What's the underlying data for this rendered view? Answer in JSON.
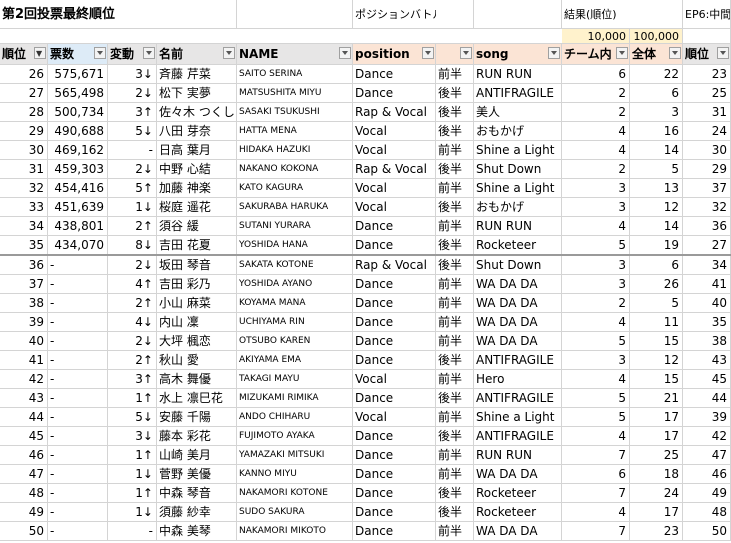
{
  "title": "第2回投票最終順位",
  "section_label": "ポジションバトル",
  "result_label": "結果(順位)",
  "ep_label": "EP6:中間",
  "value_a": "10,000",
  "value_b": "100,000",
  "headers": {
    "rank": "順位",
    "votes": "票数",
    "change": "変動",
    "name": "名前",
    "name_en": "NAME",
    "position": "position",
    "half": "",
    "song": "song",
    "team": "チーム内",
    "overall": "全体",
    "ep_rank": "順位"
  },
  "colors": {
    "header_peach": "#fbe4d5",
    "header_gray": "#e7e6e6",
    "header_teal": "#ddebf7",
    "value_yellow": "#fff2cc"
  },
  "rows": [
    {
      "rank": "26",
      "votes": "575,671",
      "change": "3↓",
      "name": "斉藤 芹菜",
      "name_en": "SAITO SERINA",
      "position": "Dance",
      "half": "前半",
      "song": "RUN RUN",
      "team": "6",
      "overall": "22",
      "ep": "23"
    },
    {
      "rank": "27",
      "votes": "565,498",
      "change": "2↓",
      "name": "松下 実夢",
      "name_en": "MATSUSHITA MIYU",
      "position": "Dance",
      "half": "後半",
      "song": "ANTIFRAGILE",
      "team": "2",
      "overall": "6",
      "ep": "25"
    },
    {
      "rank": "28",
      "votes": "500,734",
      "change": "3↑",
      "name": "佐々木 つくし",
      "name_en": "SASAKI TSUKUSHI",
      "position": "Rap & Vocal",
      "half": "後半",
      "song": "美人",
      "team": "2",
      "overall": "3",
      "ep": "31"
    },
    {
      "rank": "29",
      "votes": "490,688",
      "change": "5↓",
      "name": "八田 芽奈",
      "name_en": "HATTA MENA",
      "position": "Vocal",
      "half": "後半",
      "song": "おもかげ",
      "team": "4",
      "overall": "16",
      "ep": "24"
    },
    {
      "rank": "30",
      "votes": "469,162",
      "change": "-",
      "name": "日高 葉月",
      "name_en": "HIDAKA HAZUKI",
      "position": "Vocal",
      "half": "前半",
      "song": "Shine a Light",
      "team": "4",
      "overall": "14",
      "ep": "30"
    },
    {
      "rank": "31",
      "votes": "459,303",
      "change": "2↓",
      "name": "中野 心結",
      "name_en": "NAKANO KOKONA",
      "position": "Rap & Vocal",
      "half": "後半",
      "song": "Shut Down",
      "team": "2",
      "overall": "5",
      "ep": "29"
    },
    {
      "rank": "32",
      "votes": "454,416",
      "change": "5↑",
      "name": "加藤 神楽",
      "name_en": "KATO KAGURA",
      "position": "Vocal",
      "half": "前半",
      "song": "Shine a Light",
      "team": "3",
      "overall": "13",
      "ep": "37"
    },
    {
      "rank": "33",
      "votes": "451,639",
      "change": "1↓",
      "name": "桜庭 遥花",
      "name_en": "SAKURABA HARUKA",
      "position": "Vocal",
      "half": "後半",
      "song": "おもかげ",
      "team": "3",
      "overall": "12",
      "ep": "32"
    },
    {
      "rank": "34",
      "votes": "438,801",
      "change": "2↑",
      "name": "須谷 緩",
      "name_en": "SUTANI YURARA",
      "position": "Dance",
      "half": "前半",
      "song": "RUN RUN",
      "team": "4",
      "overall": "14",
      "ep": "36"
    },
    {
      "rank": "35",
      "votes": "434,070",
      "change": "8↓",
      "name": "吉田 花夏",
      "name_en": "YOSHIDA HANA",
      "position": "Dance",
      "half": "後半",
      "song": "Rocketeer",
      "team": "5",
      "overall": "19",
      "ep": "27"
    },
    {
      "rank": "36",
      "votes": "-",
      "change": "2↓",
      "name": "坂田 琴音",
      "name_en": "SAKATA KOTONE",
      "position": "Rap & Vocal",
      "half": "後半",
      "song": "Shut Down",
      "team": "3",
      "overall": "6",
      "ep": "34"
    },
    {
      "rank": "37",
      "votes": "-",
      "change": "4↑",
      "name": "吉田 彩乃",
      "name_en": "YOSHIDA AYANO",
      "position": "Dance",
      "half": "前半",
      "song": "WA DA DA",
      "team": "3",
      "overall": "26",
      "ep": "41"
    },
    {
      "rank": "38",
      "votes": "-",
      "change": "2↑",
      "name": "小山 麻菜",
      "name_en": "KOYAMA MANA",
      "position": "Dance",
      "half": "前半",
      "song": "WA DA DA",
      "team": "2",
      "overall": "5",
      "ep": "40"
    },
    {
      "rank": "39",
      "votes": "-",
      "change": "4↓",
      "name": "内山 凜",
      "name_en": "UCHIYAMA RIN",
      "position": "Dance",
      "half": "前半",
      "song": "WA DA DA",
      "team": "4",
      "overall": "11",
      "ep": "35"
    },
    {
      "rank": "40",
      "votes": "-",
      "change": "2↓",
      "name": "大坪 楓恋",
      "name_en": "OTSUBO KAREN",
      "position": "Dance",
      "half": "前半",
      "song": "WA DA DA",
      "team": "5",
      "overall": "15",
      "ep": "38"
    },
    {
      "rank": "41",
      "votes": "-",
      "change": "2↑",
      "name": "秋山 愛",
      "name_en": "AKIYAMA EMA",
      "position": "Dance",
      "half": "後半",
      "song": "ANTIFRAGILE",
      "team": "3",
      "overall": "12",
      "ep": "43"
    },
    {
      "rank": "42",
      "votes": "-",
      "change": "3↑",
      "name": "高木 舞優",
      "name_en": "TAKAGI MAYU",
      "position": "Vocal",
      "half": "前半",
      "song": "Hero",
      "team": "4",
      "overall": "15",
      "ep": "45"
    },
    {
      "rank": "43",
      "votes": "-",
      "change": "1↑",
      "name": "水上 凛巳花",
      "name_en": "MIZUKAMI RIMIKA",
      "position": "Dance",
      "half": "後半",
      "song": "ANTIFRAGILE",
      "team": "5",
      "overall": "21",
      "ep": "44"
    },
    {
      "rank": "44",
      "votes": "-",
      "change": "5↓",
      "name": "安藤 千陽",
      "name_en": "ANDO CHIHARU",
      "position": "Vocal",
      "half": "前半",
      "song": "Shine a Light",
      "team": "5",
      "overall": "17",
      "ep": "39"
    },
    {
      "rank": "45",
      "votes": "-",
      "change": "3↓",
      "name": "藤本 彩花",
      "name_en": "FUJIMOTO AYAKA",
      "position": "Dance",
      "half": "後半",
      "song": "ANTIFRAGILE",
      "team": "4",
      "overall": "17",
      "ep": "42"
    },
    {
      "rank": "46",
      "votes": "-",
      "change": "1↑",
      "name": "山崎 美月",
      "name_en": "YAMAZAKI MITSUKI",
      "position": "Dance",
      "half": "前半",
      "song": "RUN RUN",
      "team": "7",
      "overall": "25",
      "ep": "47"
    },
    {
      "rank": "47",
      "votes": "-",
      "change": "1↓",
      "name": "菅野 美優",
      "name_en": "KANNO MIYU",
      "position": "Dance",
      "half": "前半",
      "song": "WA DA DA",
      "team": "6",
      "overall": "18",
      "ep": "46"
    },
    {
      "rank": "48",
      "votes": "-",
      "change": "1↑",
      "name": "中森 琴音",
      "name_en": "NAKAMORI KOTONE",
      "position": "Dance",
      "half": "後半",
      "song": "Rocketeer",
      "team": "7",
      "overall": "24",
      "ep": "49"
    },
    {
      "rank": "49",
      "votes": "-",
      "change": "1↓",
      "name": "須藤 紗幸",
      "name_en": "SUDO SAKURA",
      "position": "Dance",
      "half": "後半",
      "song": "Rocketeer",
      "team": "4",
      "overall": "17",
      "ep": "48"
    },
    {
      "rank": "50",
      "votes": "-",
      "change": "-",
      "name": "中森 美琴",
      "name_en": "NAKAMORI MIKOTO",
      "position": "Dance",
      "half": "前半",
      "song": "WA DA DA",
      "team": "7",
      "overall": "23",
      "ep": "50"
    }
  ]
}
